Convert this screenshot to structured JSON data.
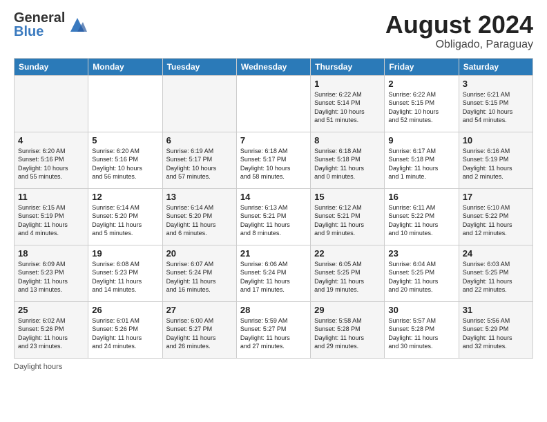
{
  "header": {
    "logo_general": "General",
    "logo_blue": "Blue",
    "month_title": "August 2024",
    "location": "Obligado, Paraguay"
  },
  "columns": [
    "Sunday",
    "Monday",
    "Tuesday",
    "Wednesday",
    "Thursday",
    "Friday",
    "Saturday"
  ],
  "weeks": [
    {
      "days": [
        {
          "num": "",
          "info": "",
          "col": "sun"
        },
        {
          "num": "",
          "info": "",
          "col": "mon"
        },
        {
          "num": "",
          "info": "",
          "col": "tue"
        },
        {
          "num": "",
          "info": "",
          "col": "wed"
        },
        {
          "num": "1",
          "info": "Sunrise: 6:22 AM\nSunset: 5:14 PM\nDaylight: 10 hours\nand 51 minutes.",
          "col": "thu"
        },
        {
          "num": "2",
          "info": "Sunrise: 6:22 AM\nSunset: 5:15 PM\nDaylight: 10 hours\nand 52 minutes.",
          "col": "fri"
        },
        {
          "num": "3",
          "info": "Sunrise: 6:21 AM\nSunset: 5:15 PM\nDaylight: 10 hours\nand 54 minutes.",
          "col": "sat"
        }
      ]
    },
    {
      "days": [
        {
          "num": "4",
          "info": "Sunrise: 6:20 AM\nSunset: 5:16 PM\nDaylight: 10 hours\nand 55 minutes.",
          "col": "sun"
        },
        {
          "num": "5",
          "info": "Sunrise: 6:20 AM\nSunset: 5:16 PM\nDaylight: 10 hours\nand 56 minutes.",
          "col": "mon"
        },
        {
          "num": "6",
          "info": "Sunrise: 6:19 AM\nSunset: 5:17 PM\nDaylight: 10 hours\nand 57 minutes.",
          "col": "tue"
        },
        {
          "num": "7",
          "info": "Sunrise: 6:18 AM\nSunset: 5:17 PM\nDaylight: 10 hours\nand 58 minutes.",
          "col": "wed"
        },
        {
          "num": "8",
          "info": "Sunrise: 6:18 AM\nSunset: 5:18 PM\nDaylight: 11 hours\nand 0 minutes.",
          "col": "thu"
        },
        {
          "num": "9",
          "info": "Sunrise: 6:17 AM\nSunset: 5:18 PM\nDaylight: 11 hours\nand 1 minute.",
          "col": "fri"
        },
        {
          "num": "10",
          "info": "Sunrise: 6:16 AM\nSunset: 5:19 PM\nDaylight: 11 hours\nand 2 minutes.",
          "col": "sat"
        }
      ]
    },
    {
      "days": [
        {
          "num": "11",
          "info": "Sunrise: 6:15 AM\nSunset: 5:19 PM\nDaylight: 11 hours\nand 4 minutes.",
          "col": "sun"
        },
        {
          "num": "12",
          "info": "Sunrise: 6:14 AM\nSunset: 5:20 PM\nDaylight: 11 hours\nand 5 minutes.",
          "col": "mon"
        },
        {
          "num": "13",
          "info": "Sunrise: 6:14 AM\nSunset: 5:20 PM\nDaylight: 11 hours\nand 6 minutes.",
          "col": "tue"
        },
        {
          "num": "14",
          "info": "Sunrise: 6:13 AM\nSunset: 5:21 PM\nDaylight: 11 hours\nand 8 minutes.",
          "col": "wed"
        },
        {
          "num": "15",
          "info": "Sunrise: 6:12 AM\nSunset: 5:21 PM\nDaylight: 11 hours\nand 9 minutes.",
          "col": "thu"
        },
        {
          "num": "16",
          "info": "Sunrise: 6:11 AM\nSunset: 5:22 PM\nDaylight: 11 hours\nand 10 minutes.",
          "col": "fri"
        },
        {
          "num": "17",
          "info": "Sunrise: 6:10 AM\nSunset: 5:22 PM\nDaylight: 11 hours\nand 12 minutes.",
          "col": "sat"
        }
      ]
    },
    {
      "days": [
        {
          "num": "18",
          "info": "Sunrise: 6:09 AM\nSunset: 5:23 PM\nDaylight: 11 hours\nand 13 minutes.",
          "col": "sun"
        },
        {
          "num": "19",
          "info": "Sunrise: 6:08 AM\nSunset: 5:23 PM\nDaylight: 11 hours\nand 14 minutes.",
          "col": "mon"
        },
        {
          "num": "20",
          "info": "Sunrise: 6:07 AM\nSunset: 5:24 PM\nDaylight: 11 hours\nand 16 minutes.",
          "col": "tue"
        },
        {
          "num": "21",
          "info": "Sunrise: 6:06 AM\nSunset: 5:24 PM\nDaylight: 11 hours\nand 17 minutes.",
          "col": "wed"
        },
        {
          "num": "22",
          "info": "Sunrise: 6:05 AM\nSunset: 5:25 PM\nDaylight: 11 hours\nand 19 minutes.",
          "col": "thu"
        },
        {
          "num": "23",
          "info": "Sunrise: 6:04 AM\nSunset: 5:25 PM\nDaylight: 11 hours\nand 20 minutes.",
          "col": "fri"
        },
        {
          "num": "24",
          "info": "Sunrise: 6:03 AM\nSunset: 5:25 PM\nDaylight: 11 hours\nand 22 minutes.",
          "col": "sat"
        }
      ]
    },
    {
      "days": [
        {
          "num": "25",
          "info": "Sunrise: 6:02 AM\nSunset: 5:26 PM\nDaylight: 11 hours\nand 23 minutes.",
          "col": "sun"
        },
        {
          "num": "26",
          "info": "Sunrise: 6:01 AM\nSunset: 5:26 PM\nDaylight: 11 hours\nand 24 minutes.",
          "col": "mon"
        },
        {
          "num": "27",
          "info": "Sunrise: 6:00 AM\nSunset: 5:27 PM\nDaylight: 11 hours\nand 26 minutes.",
          "col": "tue"
        },
        {
          "num": "28",
          "info": "Sunrise: 5:59 AM\nSunset: 5:27 PM\nDaylight: 11 hours\nand 27 minutes.",
          "col": "wed"
        },
        {
          "num": "29",
          "info": "Sunrise: 5:58 AM\nSunset: 5:28 PM\nDaylight: 11 hours\nand 29 minutes.",
          "col": "thu"
        },
        {
          "num": "30",
          "info": "Sunrise: 5:57 AM\nSunset: 5:28 PM\nDaylight: 11 hours\nand 30 minutes.",
          "col": "fri"
        },
        {
          "num": "31",
          "info": "Sunrise: 5:56 AM\nSunset: 5:29 PM\nDaylight: 11 hours\nand 32 minutes.",
          "col": "sat"
        }
      ]
    }
  ],
  "footer": "Daylight hours"
}
